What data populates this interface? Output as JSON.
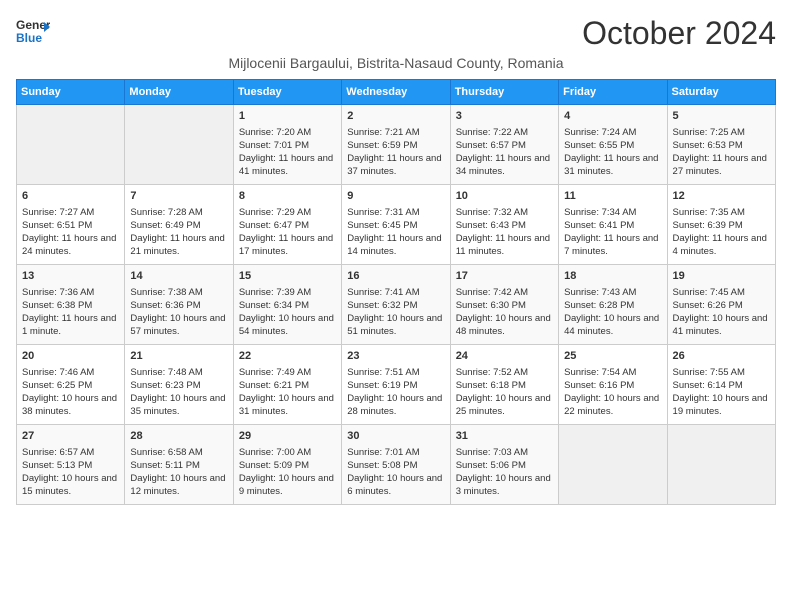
{
  "logo": {
    "line1": "General",
    "line2": "Blue"
  },
  "title": "October 2024",
  "subtitle": "Mijlocenii Bargaului, Bistrita-Nasaud County, Romania",
  "days_of_week": [
    "Sunday",
    "Monday",
    "Tuesday",
    "Wednesday",
    "Thursday",
    "Friday",
    "Saturday"
  ],
  "weeks": [
    [
      {
        "day": "",
        "info": ""
      },
      {
        "day": "",
        "info": ""
      },
      {
        "day": "1",
        "info": "Sunrise: 7:20 AM\nSunset: 7:01 PM\nDaylight: 11 hours and 41 minutes."
      },
      {
        "day": "2",
        "info": "Sunrise: 7:21 AM\nSunset: 6:59 PM\nDaylight: 11 hours and 37 minutes."
      },
      {
        "day": "3",
        "info": "Sunrise: 7:22 AM\nSunset: 6:57 PM\nDaylight: 11 hours and 34 minutes."
      },
      {
        "day": "4",
        "info": "Sunrise: 7:24 AM\nSunset: 6:55 PM\nDaylight: 11 hours and 31 minutes."
      },
      {
        "day": "5",
        "info": "Sunrise: 7:25 AM\nSunset: 6:53 PM\nDaylight: 11 hours and 27 minutes."
      }
    ],
    [
      {
        "day": "6",
        "info": "Sunrise: 7:27 AM\nSunset: 6:51 PM\nDaylight: 11 hours and 24 minutes."
      },
      {
        "day": "7",
        "info": "Sunrise: 7:28 AM\nSunset: 6:49 PM\nDaylight: 11 hours and 21 minutes."
      },
      {
        "day": "8",
        "info": "Sunrise: 7:29 AM\nSunset: 6:47 PM\nDaylight: 11 hours and 17 minutes."
      },
      {
        "day": "9",
        "info": "Sunrise: 7:31 AM\nSunset: 6:45 PM\nDaylight: 11 hours and 14 minutes."
      },
      {
        "day": "10",
        "info": "Sunrise: 7:32 AM\nSunset: 6:43 PM\nDaylight: 11 hours and 11 minutes."
      },
      {
        "day": "11",
        "info": "Sunrise: 7:34 AM\nSunset: 6:41 PM\nDaylight: 11 hours and 7 minutes."
      },
      {
        "day": "12",
        "info": "Sunrise: 7:35 AM\nSunset: 6:39 PM\nDaylight: 11 hours and 4 minutes."
      }
    ],
    [
      {
        "day": "13",
        "info": "Sunrise: 7:36 AM\nSunset: 6:38 PM\nDaylight: 11 hours and 1 minute."
      },
      {
        "day": "14",
        "info": "Sunrise: 7:38 AM\nSunset: 6:36 PM\nDaylight: 10 hours and 57 minutes."
      },
      {
        "day": "15",
        "info": "Sunrise: 7:39 AM\nSunset: 6:34 PM\nDaylight: 10 hours and 54 minutes."
      },
      {
        "day": "16",
        "info": "Sunrise: 7:41 AM\nSunset: 6:32 PM\nDaylight: 10 hours and 51 minutes."
      },
      {
        "day": "17",
        "info": "Sunrise: 7:42 AM\nSunset: 6:30 PM\nDaylight: 10 hours and 48 minutes."
      },
      {
        "day": "18",
        "info": "Sunrise: 7:43 AM\nSunset: 6:28 PM\nDaylight: 10 hours and 44 minutes."
      },
      {
        "day": "19",
        "info": "Sunrise: 7:45 AM\nSunset: 6:26 PM\nDaylight: 10 hours and 41 minutes."
      }
    ],
    [
      {
        "day": "20",
        "info": "Sunrise: 7:46 AM\nSunset: 6:25 PM\nDaylight: 10 hours and 38 minutes."
      },
      {
        "day": "21",
        "info": "Sunrise: 7:48 AM\nSunset: 6:23 PM\nDaylight: 10 hours and 35 minutes."
      },
      {
        "day": "22",
        "info": "Sunrise: 7:49 AM\nSunset: 6:21 PM\nDaylight: 10 hours and 31 minutes."
      },
      {
        "day": "23",
        "info": "Sunrise: 7:51 AM\nSunset: 6:19 PM\nDaylight: 10 hours and 28 minutes."
      },
      {
        "day": "24",
        "info": "Sunrise: 7:52 AM\nSunset: 6:18 PM\nDaylight: 10 hours and 25 minutes."
      },
      {
        "day": "25",
        "info": "Sunrise: 7:54 AM\nSunset: 6:16 PM\nDaylight: 10 hours and 22 minutes."
      },
      {
        "day": "26",
        "info": "Sunrise: 7:55 AM\nSunset: 6:14 PM\nDaylight: 10 hours and 19 minutes."
      }
    ],
    [
      {
        "day": "27",
        "info": "Sunrise: 6:57 AM\nSunset: 5:13 PM\nDaylight: 10 hours and 15 minutes."
      },
      {
        "day": "28",
        "info": "Sunrise: 6:58 AM\nSunset: 5:11 PM\nDaylight: 10 hours and 12 minutes."
      },
      {
        "day": "29",
        "info": "Sunrise: 7:00 AM\nSunset: 5:09 PM\nDaylight: 10 hours and 9 minutes."
      },
      {
        "day": "30",
        "info": "Sunrise: 7:01 AM\nSunset: 5:08 PM\nDaylight: 10 hours and 6 minutes."
      },
      {
        "day": "31",
        "info": "Sunrise: 7:03 AM\nSunset: 5:06 PM\nDaylight: 10 hours and 3 minutes."
      },
      {
        "day": "",
        "info": ""
      },
      {
        "day": "",
        "info": ""
      }
    ]
  ]
}
